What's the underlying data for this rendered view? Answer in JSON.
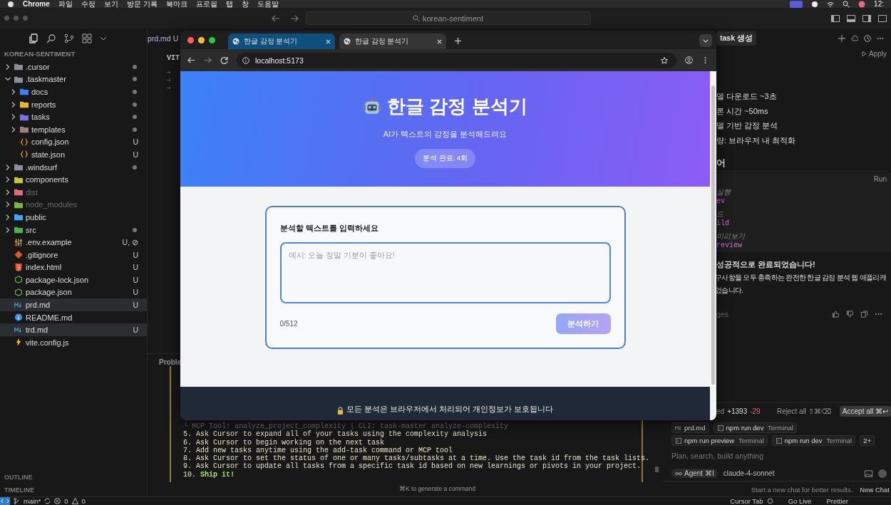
{
  "menu_bar": {
    "app": "Chrome",
    "items": [
      "파일",
      "수정",
      "보기",
      "방문 기록",
      "북마크",
      "프로필",
      "탭",
      "창",
      "도움말"
    ],
    "clock": "12:"
  },
  "title_bar": {
    "search": "korean-sentiment"
  },
  "editor_tab": {
    "label": "prd.md",
    "status": "U"
  },
  "explorer": {
    "title": "KOREAN-SENTIMENT",
    "items": [
      {
        "name": ".cursor",
        "kind": "folder",
        "color": "#8a8f98",
        "expanded": false,
        "dot": true,
        "dimmed": false,
        "selected": false
      },
      {
        "name": ".taskmaster",
        "kind": "folder",
        "color": "#8a8f98",
        "expanded": true,
        "dot": true,
        "dimmed": false,
        "selected": false,
        "children": [
          {
            "name": "docs",
            "kind": "folder",
            "color": "#3b82f6",
            "expanded": false,
            "dot": true,
            "dimmed": false,
            "selected": false
          },
          {
            "name": "reports",
            "kind": "folder",
            "color": "#e8b630",
            "expanded": false,
            "dot": true,
            "dimmed": false,
            "selected": false
          },
          {
            "name": "tasks",
            "kind": "folder",
            "color": "#7c6fe0",
            "expanded": false,
            "dot": true,
            "dimmed": false,
            "selected": false
          },
          {
            "name": "templates",
            "kind": "folder",
            "color": "#9a8478",
            "expanded": false,
            "dot": true,
            "dimmed": false,
            "selected": false
          },
          {
            "name": "config.json",
            "kind": "json",
            "git": "U",
            "dot": false,
            "dimmed": false,
            "selected": false
          },
          {
            "name": "state.json",
            "kind": "json",
            "git": "U",
            "dot": false,
            "dimmed": false,
            "selected": false
          }
        ]
      },
      {
        "name": ".windsurf",
        "kind": "folder",
        "color": "#8a8f98",
        "expanded": false,
        "dot": true,
        "dimmed": false,
        "selected": false
      },
      {
        "name": "components",
        "kind": "folder",
        "color": "#c0c640",
        "expanded": false,
        "dot": false,
        "dimmed": false,
        "selected": false
      },
      {
        "name": "dist",
        "kind": "folder",
        "color": "#e06c75",
        "expanded": false,
        "dot": false,
        "dimmed": true,
        "selected": false
      },
      {
        "name": "node_modules",
        "kind": "folder",
        "color": "#7cb342",
        "expanded": false,
        "dot": false,
        "dimmed": true,
        "selected": false
      },
      {
        "name": "public",
        "kind": "folder",
        "color": "#42a5f5",
        "expanded": false,
        "dot": false,
        "dimmed": false,
        "selected": false
      },
      {
        "name": "src",
        "kind": "folder",
        "color": "#4caf50",
        "expanded": false,
        "dot": true,
        "dimmed": false,
        "selected": false
      },
      {
        "name": ".env.example",
        "kind": "env",
        "git": "U, ⊘",
        "dot": false,
        "dimmed": false,
        "selected": false
      },
      {
        "name": ".gitignore",
        "kind": "git",
        "git": "U",
        "dot": false,
        "dimmed": false,
        "selected": false
      },
      {
        "name": "index.html",
        "kind": "html",
        "git": "U",
        "dot": false,
        "dimmed": false,
        "selected": false
      },
      {
        "name": "package-lock.json",
        "kind": "node",
        "git": "U",
        "dot": false,
        "dimmed": false,
        "selected": false
      },
      {
        "name": "package.json",
        "kind": "node",
        "git": "U",
        "dot": false,
        "dimmed": false,
        "selected": false
      },
      {
        "name": "prd.md",
        "kind": "markdown",
        "git": "U",
        "dot": false,
        "dimmed": false,
        "selected": true
      },
      {
        "name": "README.md",
        "kind": "info",
        "dot": false,
        "dimmed": false,
        "selected": false
      },
      {
        "name": "trd.md",
        "kind": "markdown",
        "git": "U",
        "dot": false,
        "dimmed": false,
        "selected": true
      },
      {
        "name": "vite.config.js",
        "kind": "vite",
        "dot": false,
        "dimmed": false,
        "selected": false
      }
    ]
  },
  "outline": "OUTLINE",
  "timeline": "TIMELINE",
  "editor": {
    "heading": "VIT",
    "arrows": [
      "→",
      "→",
      "→"
    ]
  },
  "panel": {
    "tab": "Proble",
    "lines": [
      {
        "kind": "dim",
        "text": "└ MCP Tool: analyze_project_complexity | CLI: task-master analyze-complexity"
      },
      {
        "kind": "normal",
        "number": "5.",
        "text": "Ask Cursor to expand all of your tasks using the complexity analysis"
      },
      {
        "kind": "normal",
        "number": "6.",
        "text": "Ask Cursor to begin working on the next task"
      },
      {
        "kind": "normal",
        "number": "7.",
        "text": "Add new tasks anytime using the add-task command or MCP tool"
      },
      {
        "kind": "normal",
        "number": "8.",
        "text": "Ask Cursor to set the status of one or many tasks/subtasks at a time. Use the task id from the task lists."
      },
      {
        "kind": "normal",
        "number": "9.",
        "text": "Ask Cursor to update all tasks from a specific task id based on new learnings or pivots in your project."
      },
      {
        "kind": "strong",
        "number": "10.",
        "text": "Ship it!"
      }
    ],
    "hint": "⌘K to generate a command"
  },
  "chat": {
    "title": "task 생성",
    "apply": "Apply",
    "bullets": [
      "델 다운로드 ~3초",
      "론 시간 ~50ms",
      "델 기반 감정 분석",
      "량: 브라우저 내 최적화"
    ],
    "heading": "어",
    "code": {
      "run": "Run",
      "lines": [
        {
          "kind": "comment",
          "text": "실행"
        },
        {
          "kind": "code",
          "text": "ev"
        },
        {
          "kind": "comment",
          "text": "드"
        },
        {
          "kind": "code",
          "text": "ild"
        },
        {
          "kind": "comment",
          "text": "미리보기"
        },
        {
          "kind": "code",
          "text": "review"
        }
      ]
    },
    "done_title": "성공적으로 완료되었습니다!",
    "done_text": [
      "구사항을 모두 충족하는 완전한 한글 감정 분석 웹 애플리케",
      "었습니다."
    ],
    "footer_label": "ges",
    "changes": {
      "label": "ed",
      "added": "+1393",
      "removed": "-29"
    },
    "reject": "Reject all ⇧⌘⌫",
    "accept": "Accept all ⌘↩",
    "context": [
      {
        "kind": "file",
        "label": "prd.md"
      },
      {
        "kind": "terminal",
        "label": "npm run dev",
        "suffix": "Terminal"
      },
      {
        "kind": "terminal",
        "label": "npm run preview",
        "suffix": "Terminal"
      },
      {
        "kind": "terminal",
        "label": "npm run dev",
        "suffix": "Terminal"
      },
      {
        "kind": "more",
        "label": "2+"
      }
    ],
    "placeholder": "Plan, search, build anything",
    "mode": "Agent ⌘I",
    "model": "claude-4-sonnet",
    "hint": "Start a new chat for better results.",
    "new_chat": "New Chat"
  },
  "status_bar": {
    "branch": "main*",
    "errors": "0",
    "warnings": "0",
    "right": [
      "Cursor Tab",
      "Go Live",
      "Prettier"
    ]
  },
  "browser": {
    "tabs": [
      {
        "title": "한글 감정 분석기",
        "selected": true
      },
      {
        "title": "한글 감정 분석기",
        "selected": false
      }
    ],
    "url": "localhost:5173",
    "page": {
      "title": "한글 감정 분석기",
      "subtitle": "AI가 텍스트의 감정을 분석해드려요",
      "badge": "분석 완료: 4회",
      "input_label": "분석할 텍스트를 입력하세요",
      "placeholder": "예시: 오늘 정말 기분이 좋아요!",
      "counter": "0/512",
      "button": {
        "label": "분석하기",
        "disabled": true
      },
      "footer": "모든 분석은 브라우저에서 처리되어 개인정보가 보호됩니다"
    }
  }
}
